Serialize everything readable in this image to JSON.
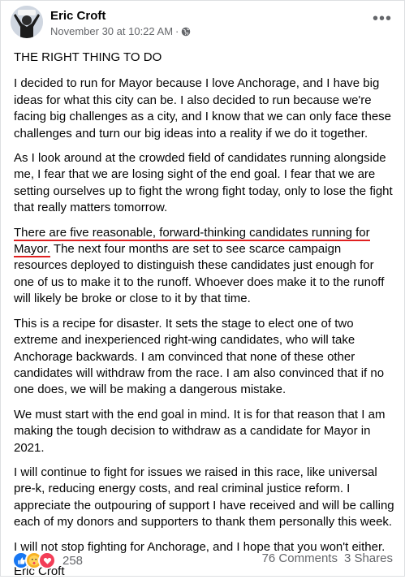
{
  "post": {
    "author": "Eric Croft",
    "timestamp": "November 30 at 10:22 AM",
    "separator": "·",
    "privacy_icon": "globe-icon",
    "more_icon": "more-options-icon",
    "title": "THE RIGHT THING TO DO",
    "paragraphs": {
      "p1": "I decided to run for Mayor because I love Anchorage, and I have big ideas for what this city can be. I also decided to run because we're facing big challenges as a city, and I know that we can only face these challenges and turn our big ideas into a reality if we do it together.",
      "p2": "As I look around at the crowded field of candidates running alongside me, I fear that we are losing sight of the end goal. I fear that we are setting ourselves up to fight the wrong fight today, only to lose the fight that really matters tomorrow.",
      "p3_highlight": "There are five reasonable, forward-thinking candidates running for Mayor.",
      "p3_rest": " The next four months are set to see scarce campaign resources deployed to distinguish these candidates just enough for one of us to make it to the runoff. Whoever does make it to the runoff will likely be broke or close to it by that time.",
      "p4": "This is a recipe for disaster. It sets the stage to elect one of two extreme and inexperienced right-wing candidates, who will take Anchorage backwards. I am convinced that none of these other candidates will withdraw from the race. I am also convinced that if no one does, we will be making a dangerous mistake.",
      "p5": "We must start with the end goal in mind. It is for that reason that I am making the tough decision to withdraw as a candidate for Mayor in 2021.",
      "p6": "I will continue to fight for issues we raised in this race, like universal pre-k, reducing energy costs, and real criminal justice reform. I appreciate the outpouring of support I have received and will be calling each of my donors and supporters to thank them personally this week.",
      "p7": "I will not stop fighting for Anchorage, and I hope that you won't either."
    },
    "signature": "Eric Croft",
    "reactions": {
      "icons": [
        "like-icon",
        "care-icon",
        "love-icon"
      ],
      "count": "258"
    },
    "comments": "76 Comments",
    "shares": "3 Shares"
  },
  "colors": {
    "text": "#050505",
    "meta": "#65676b",
    "underline": "#e02020",
    "like": "#1877f2",
    "care": "#f7b125",
    "love": "#f33e58"
  }
}
